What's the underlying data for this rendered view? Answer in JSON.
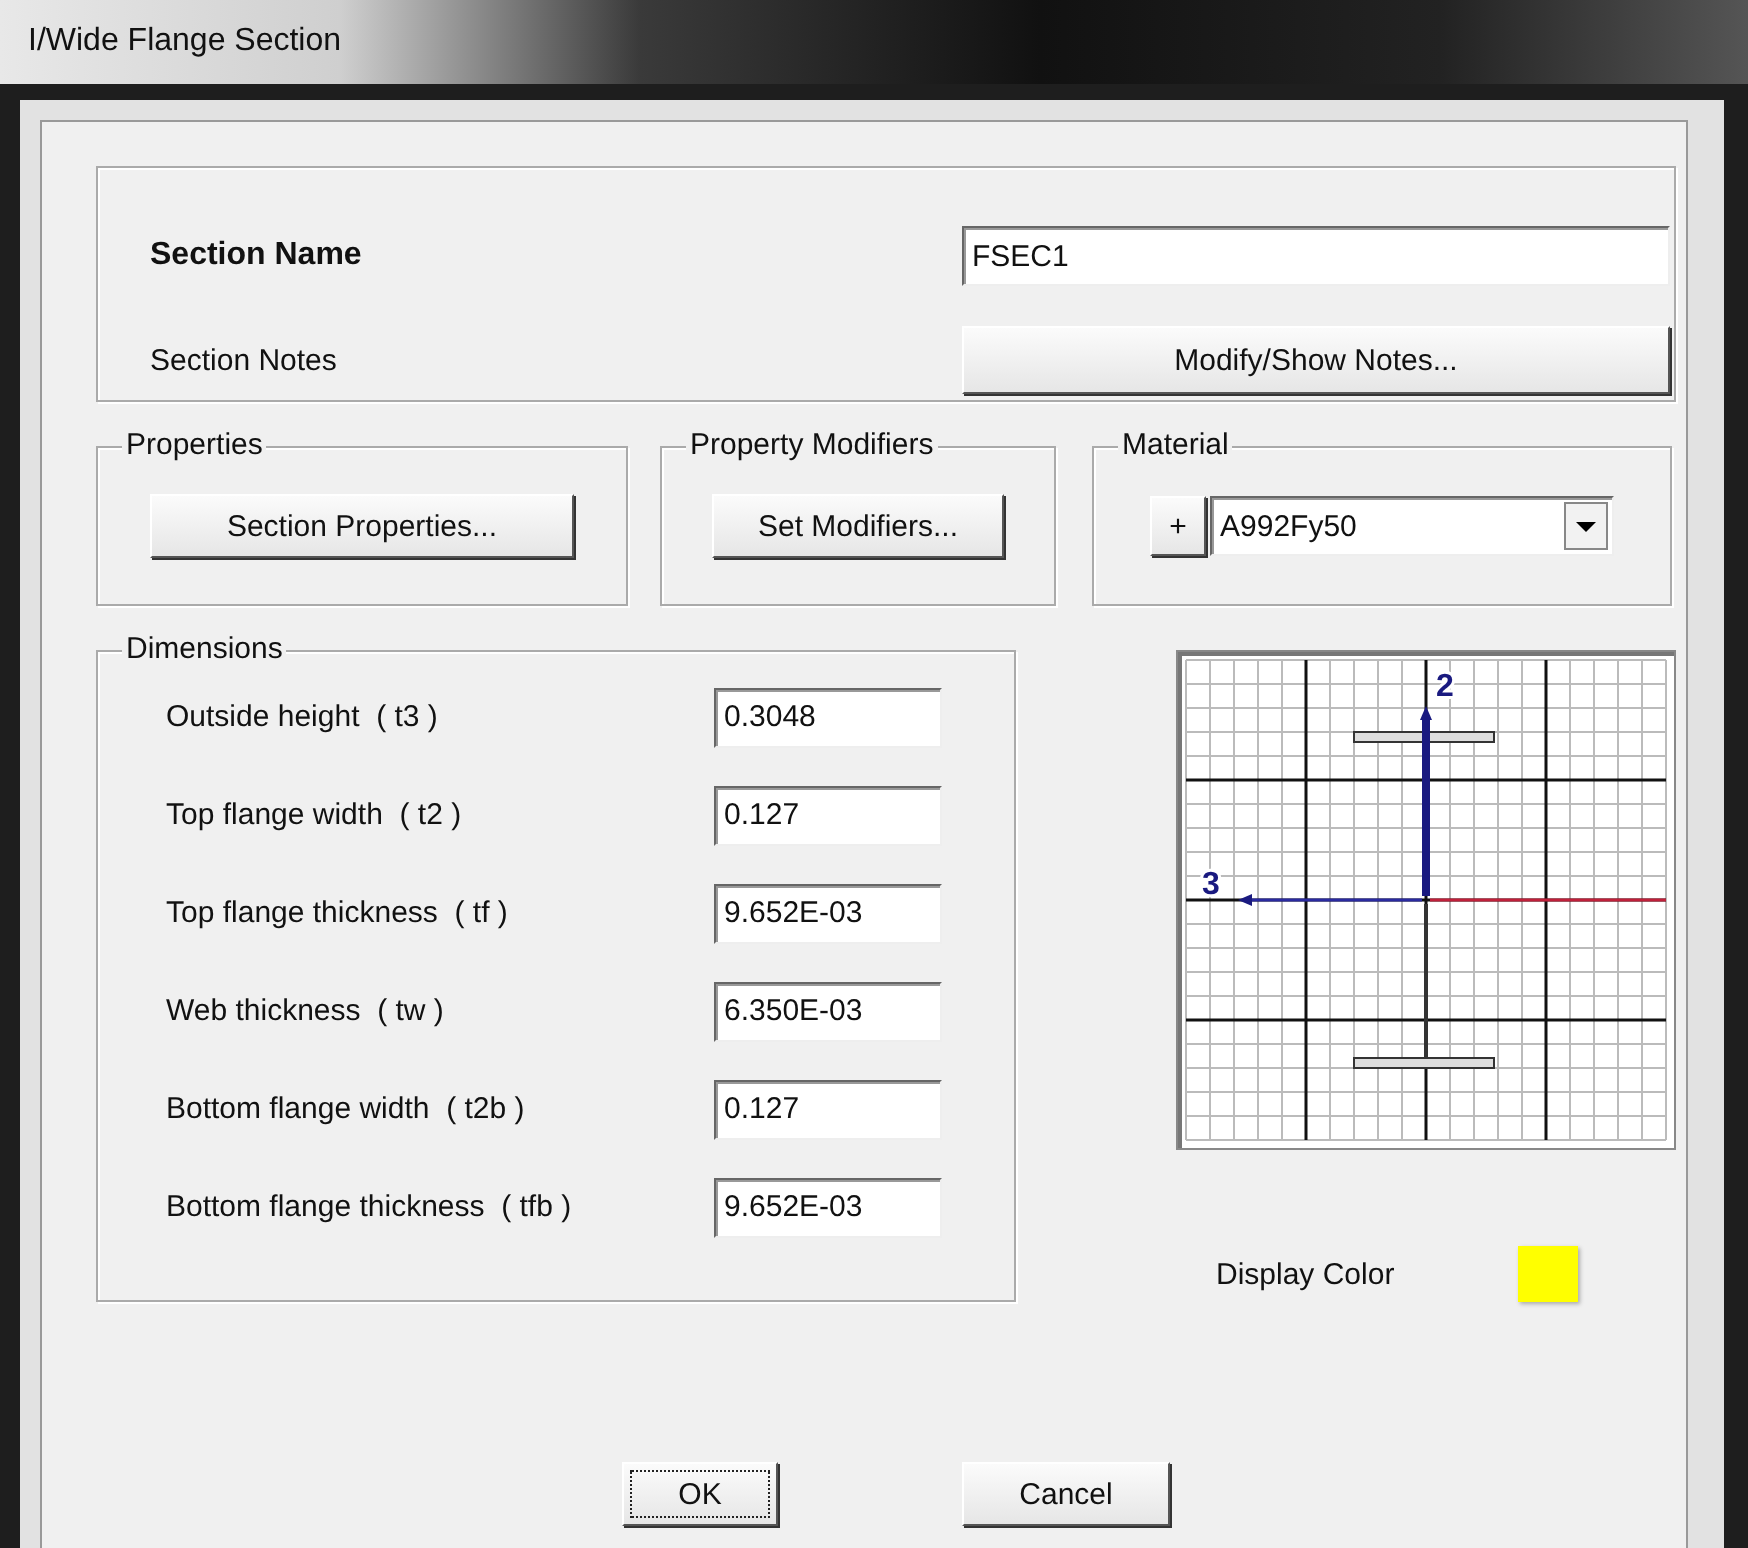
{
  "window": {
    "title": "I/Wide Flange Section"
  },
  "section": {
    "name_label": "Section Name",
    "name_value": "FSEC1",
    "notes_label": "Section Notes",
    "notes_button": "Modify/Show Notes..."
  },
  "properties": {
    "title": "Properties",
    "button": "Section Properties..."
  },
  "property_modifiers": {
    "title": "Property Modifiers",
    "button": "Set Modifiers..."
  },
  "material": {
    "title": "Material",
    "add_button": "+",
    "value": "A992Fy50"
  },
  "dimensions": {
    "title": "Dimensions",
    "rows": [
      {
        "label": "Outside height  ( t3 )",
        "value": "0.3048"
      },
      {
        "label": "Top flange width  ( t2 )",
        "value": "0.127"
      },
      {
        "label": "Top flange thickness  ( tf )",
        "value": "9.652E-03"
      },
      {
        "label": "Web thickness  ( tw )",
        "value": "6.350E-03"
      },
      {
        "label": "Bottom flange width  ( t2b )",
        "value": "0.127"
      },
      {
        "label": "Bottom flange thickness  ( tfb )",
        "value": "9.652E-03"
      }
    ]
  },
  "preview": {
    "axis_2_label": "2",
    "axis_3_label": "3"
  },
  "display_color": {
    "label": "Display Color",
    "color": "#ffff00"
  },
  "buttons": [
    {
      "label": "OK",
      "focused": true
    },
    {
      "label": "Cancel",
      "focused": false
    }
  ]
}
